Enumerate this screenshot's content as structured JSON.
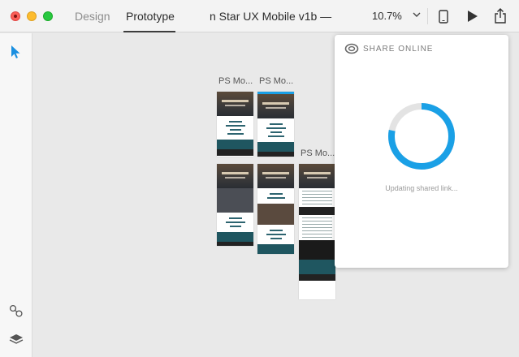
{
  "tabs": {
    "design": "Design",
    "prototype": "Prototype"
  },
  "document_title": "n Star UX Mobile v1b —",
  "zoom": {
    "value": "10.7%"
  },
  "icons": {
    "select": "arrow-pointer-icon",
    "link": "link-icon",
    "layers": "layers-icon",
    "device": "device-preview-icon",
    "play": "play-icon",
    "share": "share-icon",
    "creative_cloud": "creative-cloud-icon"
  },
  "colors": {
    "accent": "#1aa0e6",
    "spinner_track": "#e3e3e3"
  },
  "artboards": [
    {
      "label": "PS Mo..."
    },
    {
      "label": "PS Mo..."
    },
    {
      "label": "PS Mo..."
    }
  ],
  "share_panel": {
    "title": "SHARE ONLINE",
    "status": "Updating shared link...",
    "progress": 0.78
  }
}
